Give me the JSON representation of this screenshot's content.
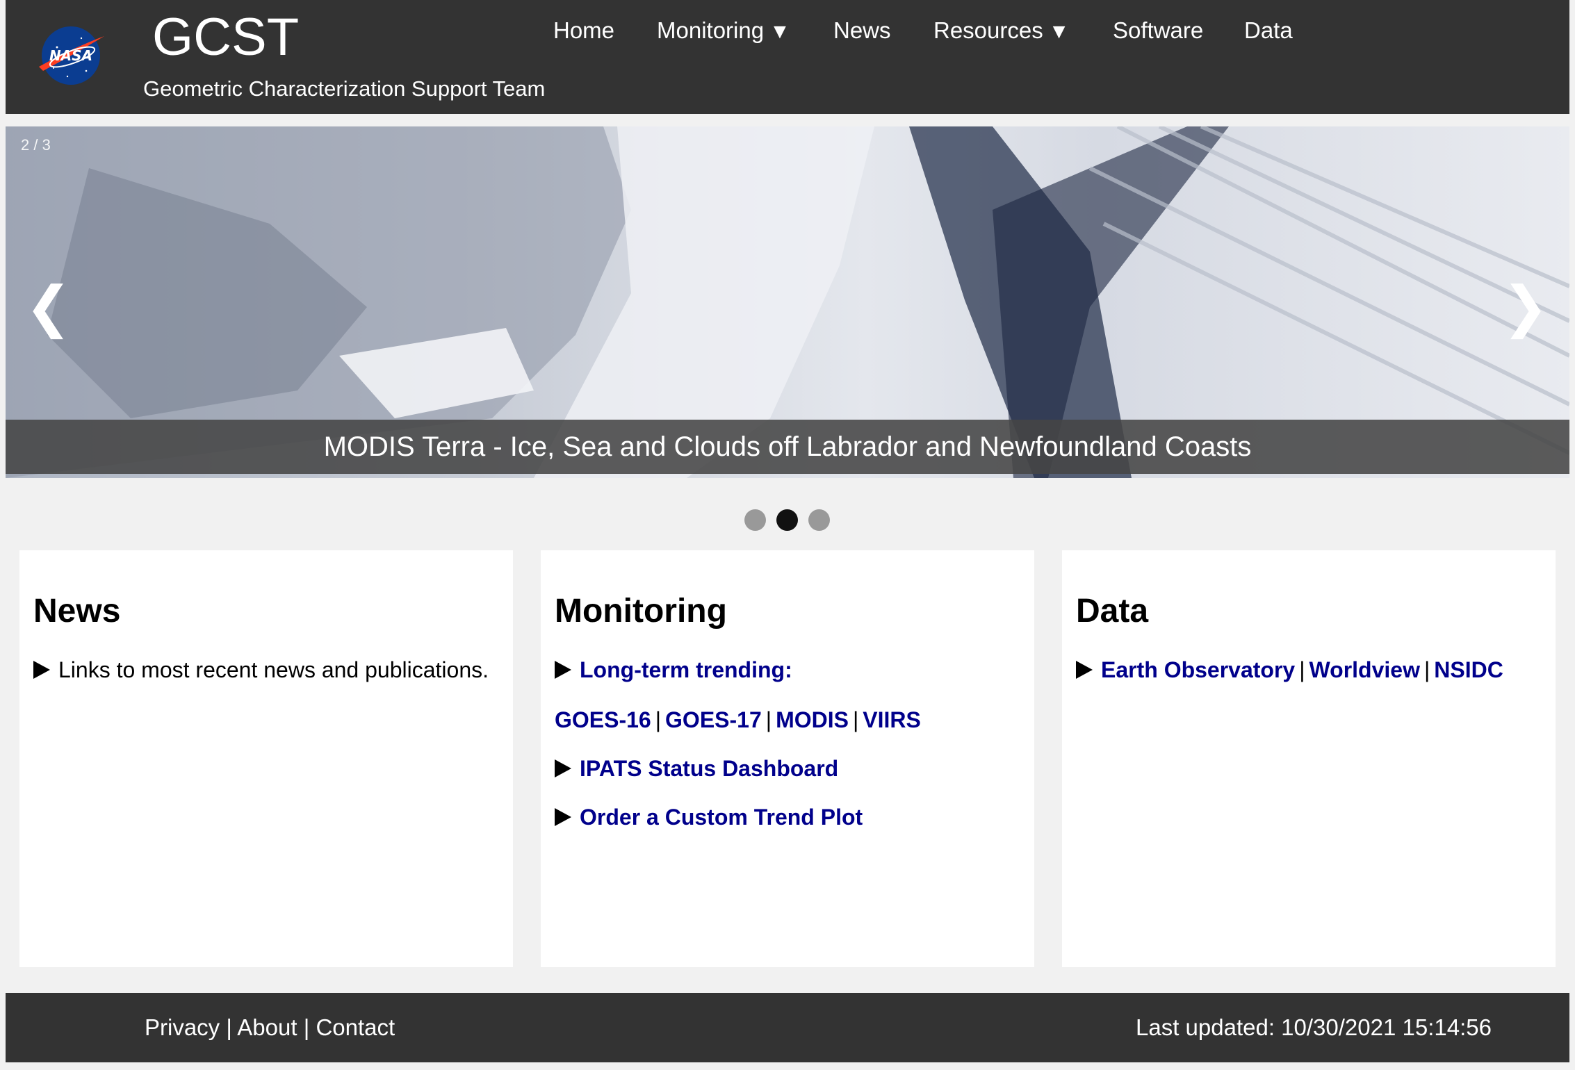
{
  "header": {
    "logo_text": "NASA",
    "title": "GCST",
    "subtitle": "Geometric Characterization Support Team"
  },
  "nav": {
    "home": "Home",
    "monitoring": "Monitoring",
    "news": "News",
    "resources": "Resources",
    "software": "Software",
    "data": "Data",
    "caret": "▼"
  },
  "slideshow": {
    "counter": "2 / 3",
    "prev": "❮",
    "next": "❯",
    "caption": "MODIS Terra - Ice, Sea and Clouds off Labrador and Newfoundland Coasts",
    "total_slides": 3,
    "active_slide": 2
  },
  "cards": {
    "news": {
      "title": "News",
      "item": "Links to most recent news and publications."
    },
    "monitoring": {
      "title": "Monitoring",
      "trending_label": "Long-term trending:",
      "trending_links": [
        "GOES-16",
        "GOES-17",
        "MODIS",
        "VIIRS"
      ],
      "separator": "|",
      "ipats": "IPATS Status Dashboard",
      "order": "Order a Custom Trend Plot"
    },
    "data": {
      "title": "Data",
      "links": [
        "Earth Observatory",
        "Worldview",
        "NSIDC"
      ]
    }
  },
  "footer": {
    "privacy": "Privacy",
    "about": "About",
    "contact": "Contact",
    "separator": "|",
    "last_updated": "Last updated: 10/30/2021 15:14:56"
  },
  "colors": {
    "header_bg": "#333333",
    "page_bg": "#f1f1f1",
    "link": "#00008b",
    "active_dot": "#111111",
    "inactive_dot": "#999999"
  },
  "icons": {
    "logo": "nasa-meatball-logo",
    "bullet": "right-triangle-icon"
  }
}
